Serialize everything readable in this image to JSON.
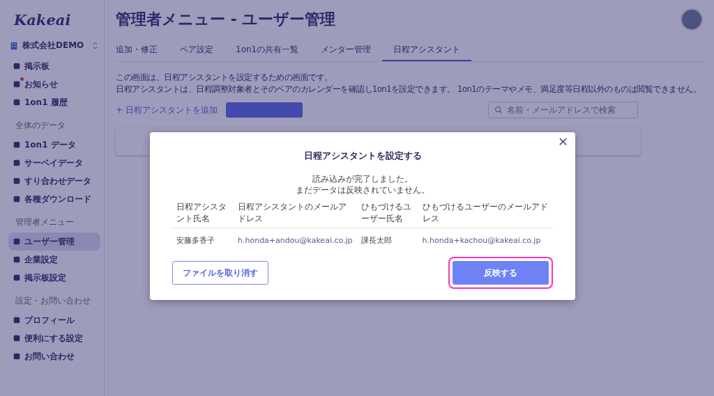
{
  "logo": "Kakeai",
  "company": "株式会社DEMO",
  "sidebar": {
    "sections": [
      {
        "items": [
          {
            "label": "掲示板",
            "selected": false,
            "badge": false
          },
          {
            "label": "お知らせ",
            "selected": false,
            "badge": true
          },
          {
            "label": "1on1 履歴",
            "selected": false,
            "badge": false
          }
        ]
      },
      {
        "heading": "全体のデータ",
        "items": [
          {
            "label": "1on1 データ",
            "selected": false,
            "badge": false
          },
          {
            "label": "サーベイデータ",
            "selected": false,
            "badge": false
          },
          {
            "label": "すり合わせデータ",
            "selected": false,
            "badge": false
          },
          {
            "label": "各種ダウンロード",
            "selected": false,
            "badge": false
          }
        ]
      },
      {
        "heading": "管理者メニュー",
        "items": [
          {
            "label": "ユーザー管理",
            "selected": true,
            "badge": false
          },
          {
            "label": "企業設定",
            "selected": false,
            "badge": false
          },
          {
            "label": "掲示板設定",
            "selected": false,
            "badge": false
          }
        ]
      },
      {
        "heading": "設定・お問い合わせ",
        "items": [
          {
            "label": "プロフィール",
            "selected": false,
            "badge": false
          },
          {
            "label": "便利にする設定",
            "selected": false,
            "badge": false
          },
          {
            "label": "お問い合わせ",
            "selected": false,
            "badge": false
          }
        ]
      }
    ]
  },
  "page_title": "管理者メニュー - ユーザー管理",
  "tabs": [
    {
      "label": "追加・修正",
      "selected": false
    },
    {
      "label": "ペア設定",
      "selected": false
    },
    {
      "label": "1on1の共有一覧",
      "selected": false
    },
    {
      "label": "メンター管理",
      "selected": false
    },
    {
      "label": "日程アシスタント",
      "selected": true
    }
  ],
  "description": [
    "この画面は、日程アシスタントを設定するための画面です。",
    "日程アシスタントは、日程調整対象者とそのペアのカレンダーを確認し1on1を設定できます。 1on1のテーマやメモ、満足度等日程以外のものは閲覧できません。"
  ],
  "add_link": "+ 日程アシスタントを追加",
  "search": {
    "placeholder": "名前・メールアドレスで検索"
  },
  "modal": {
    "title": "日程アシスタントを設定する",
    "messages": [
      "読み込みが完了しました。",
      "まだデータは反映されていません。"
    ],
    "columns": [
      "日程アシスタント氏名",
      "日程アシスタントのメールアドレス",
      "ひもづけるユーザー氏名",
      "ひもづけるユーザーのメールアドレス"
    ],
    "rows": [
      [
        "安藤多香子",
        "h.honda+andou@kakeai.co.jp",
        "課長太郎",
        "h.honda+kachou@kakeai.co.jp"
      ]
    ],
    "cancel_button": "ファイルを取り消す",
    "confirm_button": "反映する",
    "confirm_highlighted": true
  }
}
